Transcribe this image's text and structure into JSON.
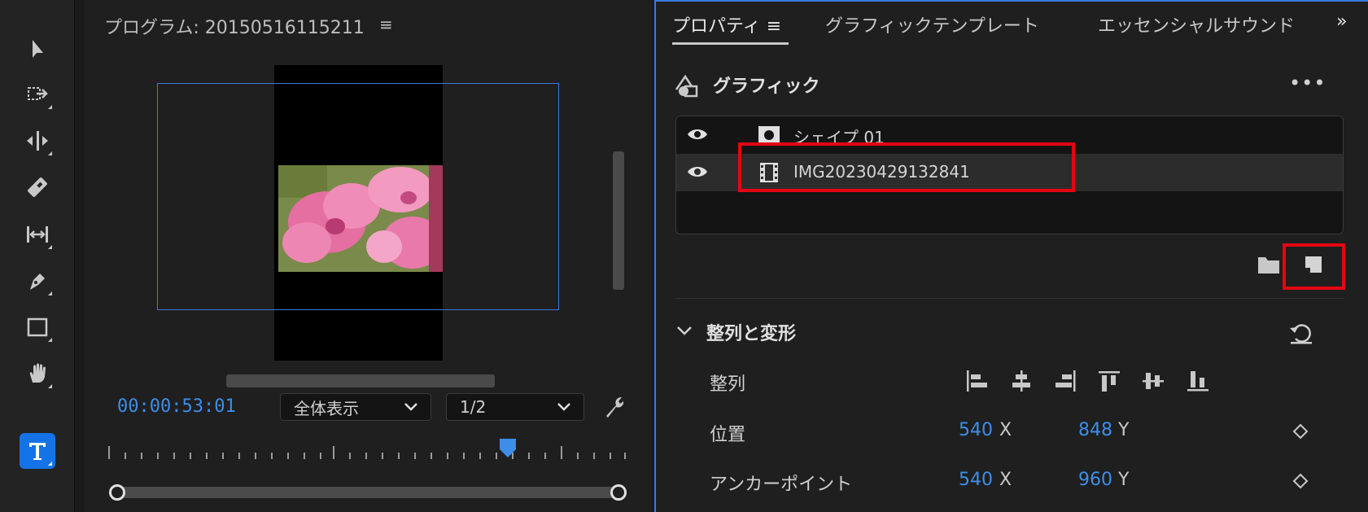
{
  "program": {
    "title": "プログラム: 20150516115211",
    "timecode": "00:00:53:01",
    "fit_select": "全体表示",
    "resolution_select": "1/2"
  },
  "tools": [
    {
      "name": "selection-tool-icon"
    },
    {
      "name": "track-select-tool-icon"
    },
    {
      "name": "ripple-edit-tool-icon"
    },
    {
      "name": "razor-tool-icon"
    },
    {
      "name": "slip-tool-icon"
    },
    {
      "name": "pen-tool-icon"
    },
    {
      "name": "rectangle-tool-icon"
    },
    {
      "name": "hand-tool-icon"
    },
    {
      "name": "type-tool-icon"
    }
  ],
  "properties": {
    "tabs": {
      "properties": "プロパティ",
      "graphic_templates": "グラフィックテンプレート",
      "essential_sound": "エッセンシャルサウンド",
      "more": "»"
    },
    "graphic_heading": "グラフィック",
    "more_menu": "•••",
    "layers": [
      {
        "name": "シェイプ 01",
        "icon": "shape-icon"
      },
      {
        "name": "IMG20230429132841",
        "icon": "film-icon"
      }
    ],
    "section_title": "整列と変形",
    "align_label": "整列",
    "position_label": "位置",
    "position_x": "540",
    "position_y": "848",
    "anchor_label": "アンカーポイント",
    "anchor_x": "540",
    "anchor_y": "960",
    "axis_x": "X",
    "axis_y": "Y"
  },
  "colors": {
    "accent": "#3d8ee8",
    "highlight_box": "#e30613",
    "panel_border": "#3c7ad8"
  }
}
